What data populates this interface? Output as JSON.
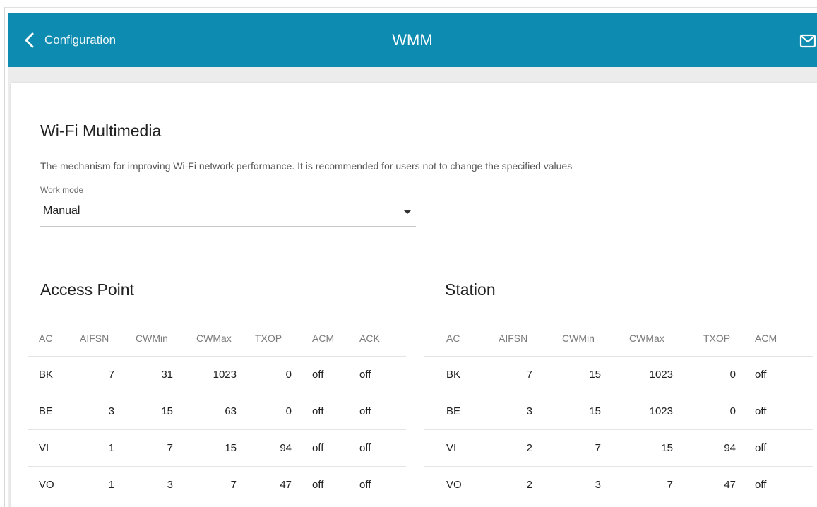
{
  "header": {
    "back_label": "Configuration",
    "title": "WMM",
    "accent_color": "#0d8bb0",
    "icons": {
      "back": "chevron-left-icon",
      "notifications": "mail-icon"
    }
  },
  "section": {
    "title": "Wi-Fi Multimedia",
    "description": "The mechanism for improving Wi-Fi network performance. It is recommended for users not to change the specified values",
    "work_mode": {
      "label": "Work mode",
      "value": "Manual"
    }
  },
  "access_point": {
    "title": "Access Point",
    "columns": [
      "AC",
      "AIFSN",
      "CWMin",
      "CWMax",
      "TXOP",
      "ACM",
      "ACK"
    ],
    "rows": [
      [
        "BK",
        "7",
        "31",
        "1023",
        "0",
        "off",
        "off"
      ],
      [
        "BE",
        "3",
        "15",
        "63",
        "0",
        "off",
        "off"
      ],
      [
        "VI",
        "1",
        "7",
        "15",
        "94",
        "off",
        "off"
      ],
      [
        "VO",
        "1",
        "3",
        "7",
        "47",
        "off",
        "off"
      ]
    ]
  },
  "station": {
    "title": "Station",
    "columns": [
      "AC",
      "AIFSN",
      "CWMin",
      "CWMax",
      "TXOP",
      "ACM"
    ],
    "rows": [
      [
        "BK",
        "7",
        "15",
        "1023",
        "0",
        "off"
      ],
      [
        "BE",
        "3",
        "15",
        "1023",
        "0",
        "off"
      ],
      [
        "VI",
        "2",
        "7",
        "15",
        "94",
        "off"
      ],
      [
        "VO",
        "2",
        "3",
        "7",
        "47",
        "off"
      ]
    ]
  }
}
